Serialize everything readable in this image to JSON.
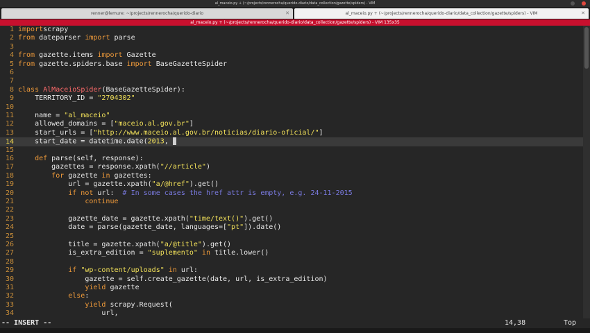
{
  "window": {
    "title": "al_maceio.py + (~/projects/rennerocha/querido-diario/data_collection/gazette/spiders) - VIM"
  },
  "tabs": [
    {
      "label": "renner@lemure: ~/projects/rennerocha/querido-diario"
    },
    {
      "label": "al_maceio.py + (~/projects/rennerocha/querido-diario/data_collection/gazette/spiders) - VIM"
    }
  ],
  "vim": {
    "title": "al_maceio.py + (~/projects/rennerocha/querido-diario/data_collection/gazette/spiders) - VIM 135x35",
    "mode": "-- INSERT --",
    "position": "14,38",
    "scroll": "Top",
    "current_line": 14,
    "lines": [
      {
        "n": "1",
        "segs": [
          [
            "kw",
            "import"
          ],
          [
            "",
            "scrapy"
          ]
        ]
      },
      {
        "n": "2",
        "segs": [
          [
            "kw",
            "from"
          ],
          [
            "",
            " dateparser "
          ],
          [
            "kw",
            "import"
          ],
          [
            "",
            " parse"
          ]
        ]
      },
      {
        "n": "3",
        "segs": []
      },
      {
        "n": "4",
        "segs": [
          [
            "kw",
            "from"
          ],
          [
            "",
            " gazette.items "
          ],
          [
            "kw",
            "import"
          ],
          [
            "",
            " Gazette"
          ]
        ]
      },
      {
        "n": "5",
        "segs": [
          [
            "kw",
            "from"
          ],
          [
            "",
            " gazette.spiders.base "
          ],
          [
            "kw",
            "import"
          ],
          [
            "",
            " BaseGazetteSpider"
          ]
        ]
      },
      {
        "n": "6",
        "segs": []
      },
      {
        "n": "7",
        "segs": []
      },
      {
        "n": "8",
        "segs": [
          [
            "kw",
            "class"
          ],
          [
            "",
            " "
          ],
          [
            "nm",
            "AlMaceioSpider"
          ],
          [
            "",
            "(BaseGazetteSpider):"
          ]
        ]
      },
      {
        "n": "9",
        "segs": [
          [
            "",
            "    TERRITORY_ID = "
          ],
          [
            "st",
            "\"2704302\""
          ]
        ]
      },
      {
        "n": "10",
        "segs": []
      },
      {
        "n": "11",
        "segs": [
          [
            "",
            "    name = "
          ],
          [
            "st",
            "\"al_maceio\""
          ]
        ]
      },
      {
        "n": "12",
        "segs": [
          [
            "",
            "    allowed_domains = ["
          ],
          [
            "st",
            "\"maceio.al.gov.br\""
          ],
          [
            "",
            "]"
          ]
        ]
      },
      {
        "n": "13",
        "segs": [
          [
            "",
            "    start_urls = ["
          ],
          [
            "st",
            "\"http://www.maceio.al.gov.br/noticias/diario-oficial/\""
          ],
          [
            "",
            "]"
          ]
        ]
      },
      {
        "n": "14",
        "segs": [
          [
            "",
            "    start_date = datetime.date("
          ],
          [
            "st",
            "2013"
          ],
          [
            "",
            ", "
          ],
          [
            "cursor",
            ""
          ]
        ]
      },
      {
        "n": "15",
        "segs": []
      },
      {
        "n": "16",
        "segs": [
          [
            "",
            "    "
          ],
          [
            "kw",
            "def"
          ],
          [
            "",
            " parse(self, response):"
          ]
        ]
      },
      {
        "n": "17",
        "segs": [
          [
            "",
            "        gazettes = response.xpath("
          ],
          [
            "st",
            "\"//article\""
          ],
          [
            "",
            ")"
          ]
        ]
      },
      {
        "n": "18",
        "segs": [
          [
            "",
            "        "
          ],
          [
            "kw",
            "for"
          ],
          [
            "",
            " gazette "
          ],
          [
            "kw",
            "in"
          ],
          [
            "",
            " gazettes:"
          ]
        ]
      },
      {
        "n": "19",
        "segs": [
          [
            "",
            "            url = gazette.xpath("
          ],
          [
            "st",
            "\"a/@href\""
          ],
          [
            "",
            ").get()"
          ]
        ]
      },
      {
        "n": "20",
        "segs": [
          [
            "",
            "            "
          ],
          [
            "kw",
            "if not"
          ],
          [
            "",
            " url:  "
          ],
          [
            "cm",
            "# In some cases the href attr is empty, e.g. 24-11-2015"
          ]
        ]
      },
      {
        "n": "21",
        "segs": [
          [
            "",
            "                "
          ],
          [
            "kw",
            "continue"
          ]
        ]
      },
      {
        "n": "22",
        "segs": []
      },
      {
        "n": "23",
        "segs": [
          [
            "",
            "            gazette_date = gazette.xpath("
          ],
          [
            "st",
            "\"time/text()\""
          ],
          [
            "",
            ").get()"
          ]
        ]
      },
      {
        "n": "24",
        "segs": [
          [
            "",
            "            date = parse(gazette_date, languages=["
          ],
          [
            "st",
            "\"pt\""
          ],
          [
            "",
            "]).date()"
          ]
        ]
      },
      {
        "n": "25",
        "segs": []
      },
      {
        "n": "26",
        "segs": [
          [
            "",
            "            title = gazette.xpath("
          ],
          [
            "st",
            "\"a/@title\""
          ],
          [
            "",
            ").get()"
          ]
        ]
      },
      {
        "n": "27",
        "segs": [
          [
            "",
            "            is_extra_edition = "
          ],
          [
            "st",
            "\"suplemento\""
          ],
          [
            "",
            " "
          ],
          [
            "kw",
            "in"
          ],
          [
            "",
            " title.lower()"
          ]
        ]
      },
      {
        "n": "28",
        "segs": []
      },
      {
        "n": "29",
        "segs": [
          [
            "",
            "            "
          ],
          [
            "kw",
            "if"
          ],
          [
            "",
            " "
          ],
          [
            "st",
            "\"wp-content/uploads\""
          ],
          [
            "",
            " "
          ],
          [
            "kw",
            "in"
          ],
          [
            "",
            " url:"
          ]
        ]
      },
      {
        "n": "30",
        "segs": [
          [
            "",
            "                gazette = self.create_gazette(date, url, is_extra_edition)"
          ]
        ]
      },
      {
        "n": "31",
        "segs": [
          [
            "",
            "                "
          ],
          [
            "kw",
            "yield"
          ],
          [
            "",
            " gazette"
          ]
        ]
      },
      {
        "n": "32",
        "segs": [
          [
            "",
            "            "
          ],
          [
            "kw",
            "else"
          ],
          [
            "",
            ":"
          ]
        ]
      },
      {
        "n": "33",
        "segs": [
          [
            "",
            "                "
          ],
          [
            "kw",
            "yield"
          ],
          [
            "",
            " scrapy.Request("
          ]
        ]
      },
      {
        "n": "34",
        "segs": [
          [
            "",
            "                    url,"
          ]
        ]
      }
    ]
  }
}
